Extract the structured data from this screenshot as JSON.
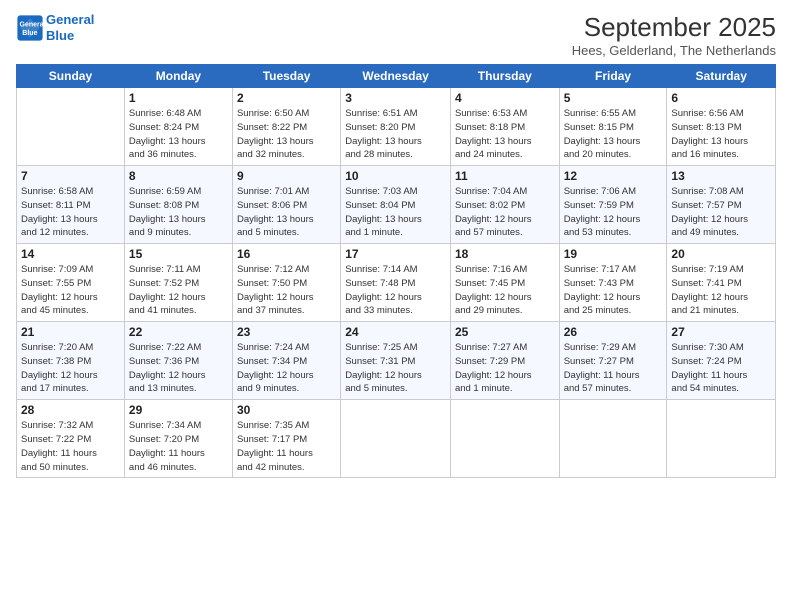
{
  "header": {
    "logo_line1": "General",
    "logo_line2": "Blue",
    "month": "September 2025",
    "location": "Hees, Gelderland, The Netherlands"
  },
  "days_of_week": [
    "Sunday",
    "Monday",
    "Tuesday",
    "Wednesday",
    "Thursday",
    "Friday",
    "Saturday"
  ],
  "weeks": [
    [
      {
        "num": "",
        "info": ""
      },
      {
        "num": "1",
        "info": "Sunrise: 6:48 AM\nSunset: 8:24 PM\nDaylight: 13 hours\nand 36 minutes."
      },
      {
        "num": "2",
        "info": "Sunrise: 6:50 AM\nSunset: 8:22 PM\nDaylight: 13 hours\nand 32 minutes."
      },
      {
        "num": "3",
        "info": "Sunrise: 6:51 AM\nSunset: 8:20 PM\nDaylight: 13 hours\nand 28 minutes."
      },
      {
        "num": "4",
        "info": "Sunrise: 6:53 AM\nSunset: 8:18 PM\nDaylight: 13 hours\nand 24 minutes."
      },
      {
        "num": "5",
        "info": "Sunrise: 6:55 AM\nSunset: 8:15 PM\nDaylight: 13 hours\nand 20 minutes."
      },
      {
        "num": "6",
        "info": "Sunrise: 6:56 AM\nSunset: 8:13 PM\nDaylight: 13 hours\nand 16 minutes."
      }
    ],
    [
      {
        "num": "7",
        "info": "Sunrise: 6:58 AM\nSunset: 8:11 PM\nDaylight: 13 hours\nand 12 minutes."
      },
      {
        "num": "8",
        "info": "Sunrise: 6:59 AM\nSunset: 8:08 PM\nDaylight: 13 hours\nand 9 minutes."
      },
      {
        "num": "9",
        "info": "Sunrise: 7:01 AM\nSunset: 8:06 PM\nDaylight: 13 hours\nand 5 minutes."
      },
      {
        "num": "10",
        "info": "Sunrise: 7:03 AM\nSunset: 8:04 PM\nDaylight: 13 hours\nand 1 minute."
      },
      {
        "num": "11",
        "info": "Sunrise: 7:04 AM\nSunset: 8:02 PM\nDaylight: 12 hours\nand 57 minutes."
      },
      {
        "num": "12",
        "info": "Sunrise: 7:06 AM\nSunset: 7:59 PM\nDaylight: 12 hours\nand 53 minutes."
      },
      {
        "num": "13",
        "info": "Sunrise: 7:08 AM\nSunset: 7:57 PM\nDaylight: 12 hours\nand 49 minutes."
      }
    ],
    [
      {
        "num": "14",
        "info": "Sunrise: 7:09 AM\nSunset: 7:55 PM\nDaylight: 12 hours\nand 45 minutes."
      },
      {
        "num": "15",
        "info": "Sunrise: 7:11 AM\nSunset: 7:52 PM\nDaylight: 12 hours\nand 41 minutes."
      },
      {
        "num": "16",
        "info": "Sunrise: 7:12 AM\nSunset: 7:50 PM\nDaylight: 12 hours\nand 37 minutes."
      },
      {
        "num": "17",
        "info": "Sunrise: 7:14 AM\nSunset: 7:48 PM\nDaylight: 12 hours\nand 33 minutes."
      },
      {
        "num": "18",
        "info": "Sunrise: 7:16 AM\nSunset: 7:45 PM\nDaylight: 12 hours\nand 29 minutes."
      },
      {
        "num": "19",
        "info": "Sunrise: 7:17 AM\nSunset: 7:43 PM\nDaylight: 12 hours\nand 25 minutes."
      },
      {
        "num": "20",
        "info": "Sunrise: 7:19 AM\nSunset: 7:41 PM\nDaylight: 12 hours\nand 21 minutes."
      }
    ],
    [
      {
        "num": "21",
        "info": "Sunrise: 7:20 AM\nSunset: 7:38 PM\nDaylight: 12 hours\nand 17 minutes."
      },
      {
        "num": "22",
        "info": "Sunrise: 7:22 AM\nSunset: 7:36 PM\nDaylight: 12 hours\nand 13 minutes."
      },
      {
        "num": "23",
        "info": "Sunrise: 7:24 AM\nSunset: 7:34 PM\nDaylight: 12 hours\nand 9 minutes."
      },
      {
        "num": "24",
        "info": "Sunrise: 7:25 AM\nSunset: 7:31 PM\nDaylight: 12 hours\nand 5 minutes."
      },
      {
        "num": "25",
        "info": "Sunrise: 7:27 AM\nSunset: 7:29 PM\nDaylight: 12 hours\nand 1 minute."
      },
      {
        "num": "26",
        "info": "Sunrise: 7:29 AM\nSunset: 7:27 PM\nDaylight: 11 hours\nand 57 minutes."
      },
      {
        "num": "27",
        "info": "Sunrise: 7:30 AM\nSunset: 7:24 PM\nDaylight: 11 hours\nand 54 minutes."
      }
    ],
    [
      {
        "num": "28",
        "info": "Sunrise: 7:32 AM\nSunset: 7:22 PM\nDaylight: 11 hours\nand 50 minutes."
      },
      {
        "num": "29",
        "info": "Sunrise: 7:34 AM\nSunset: 7:20 PM\nDaylight: 11 hours\nand 46 minutes."
      },
      {
        "num": "30",
        "info": "Sunrise: 7:35 AM\nSunset: 7:17 PM\nDaylight: 11 hours\nand 42 minutes."
      },
      {
        "num": "",
        "info": ""
      },
      {
        "num": "",
        "info": ""
      },
      {
        "num": "",
        "info": ""
      },
      {
        "num": "",
        "info": ""
      }
    ]
  ]
}
